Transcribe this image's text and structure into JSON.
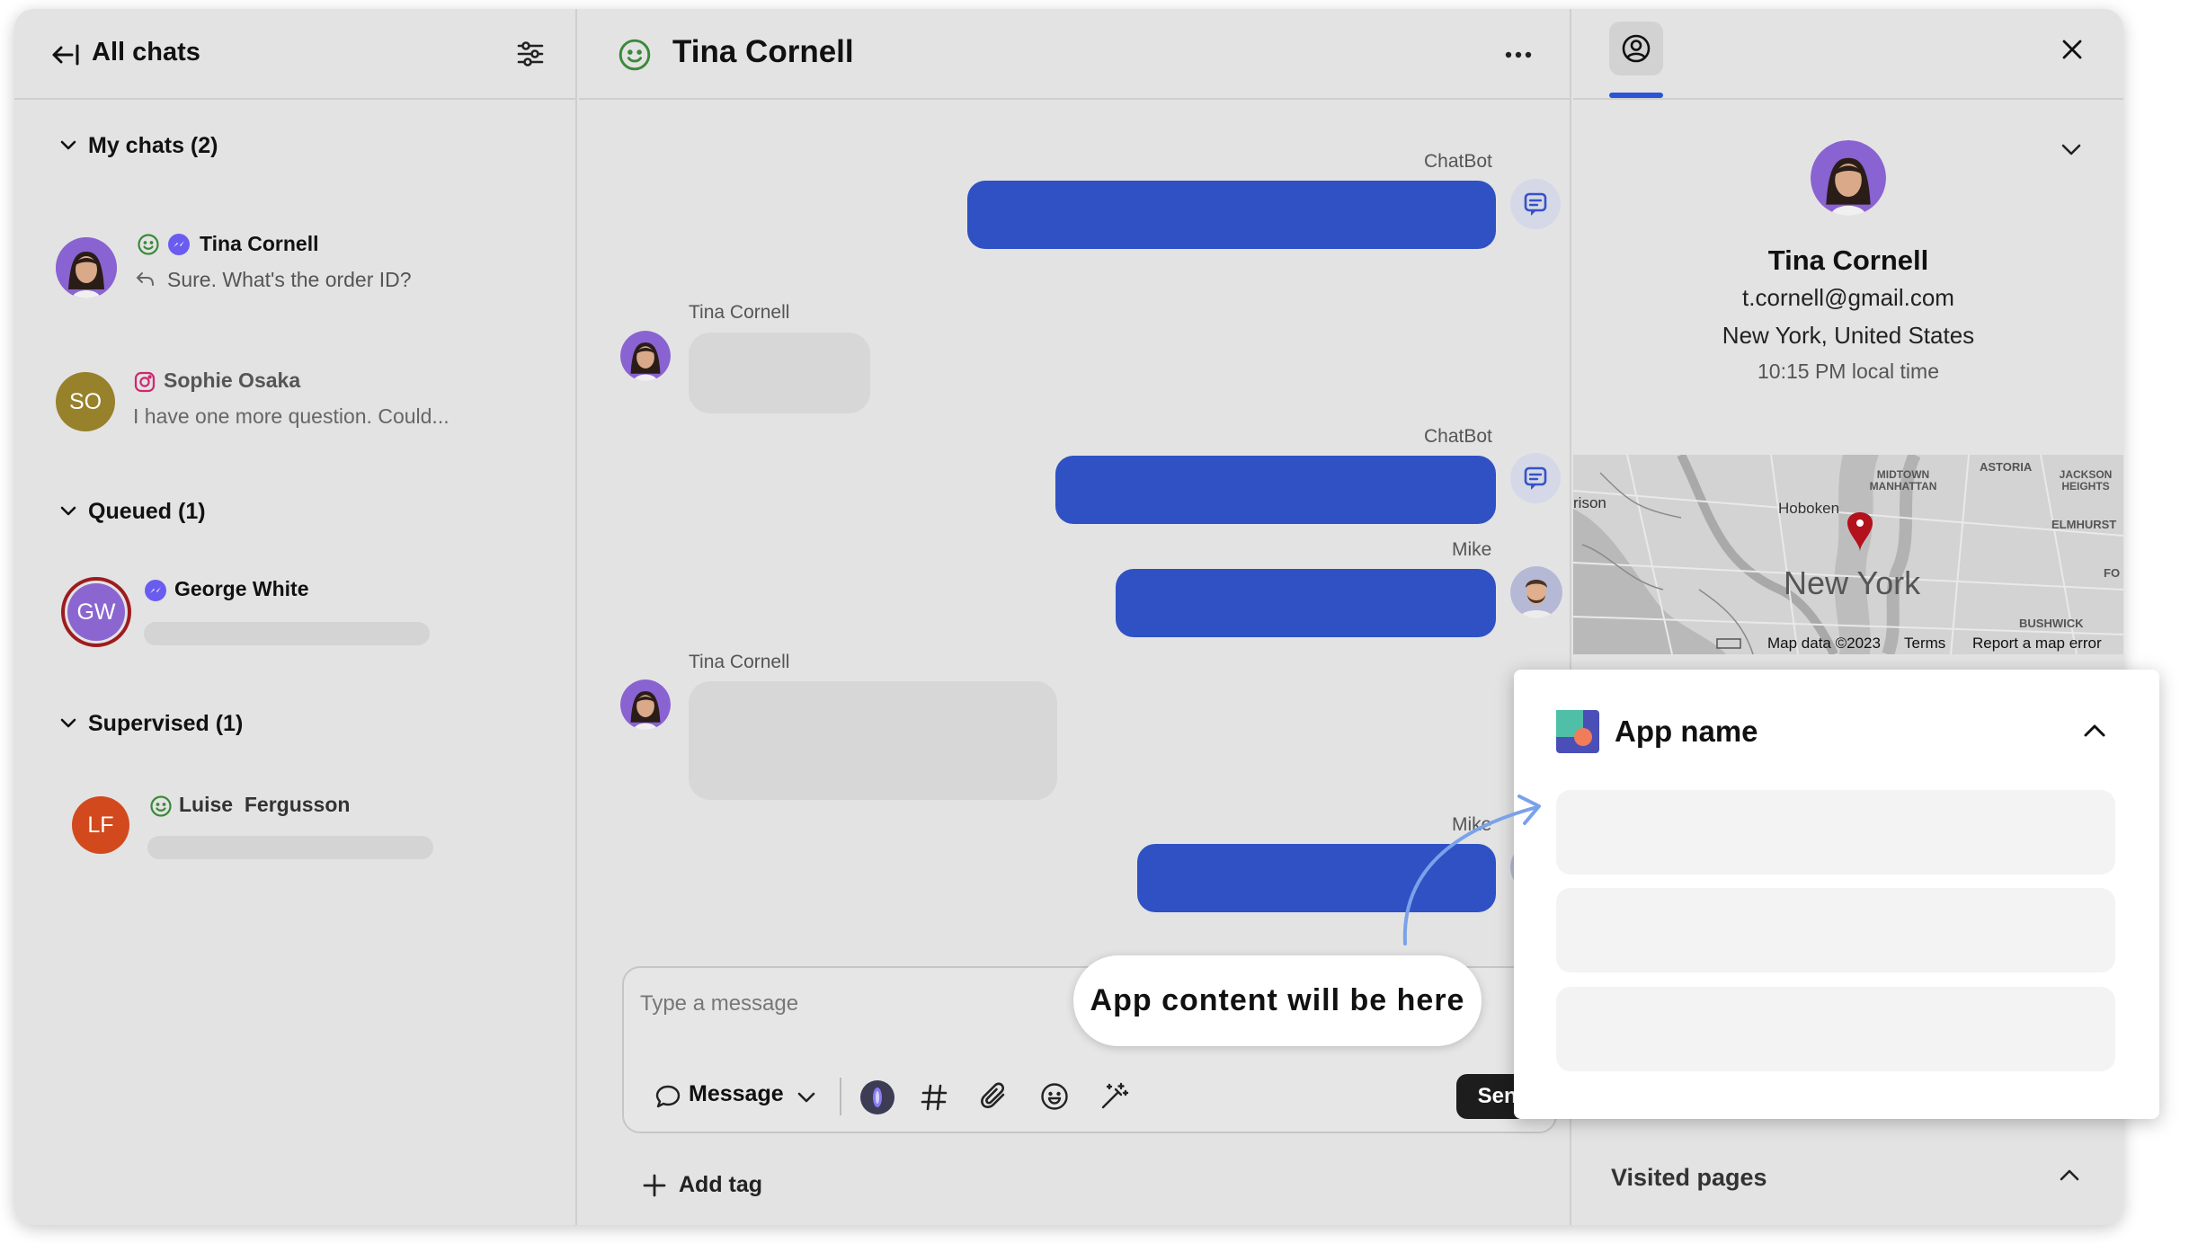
{
  "left_panel": {
    "title": "All chats",
    "sections": {
      "my_chats": "My chats (2)",
      "queued": "Queued (1)",
      "supervised": "Supervised (1)"
    },
    "chats": [
      {
        "name": "Tina Cornell",
        "preview": "Sure. What's the order ID?"
      },
      {
        "initials": "SO",
        "name": "Sophie Osaka",
        "preview": "I have one more question. Could..."
      },
      {
        "initials": "GW",
        "name": "George White"
      },
      {
        "initials": "LF",
        "name": "Luise  Fergusson"
      }
    ]
  },
  "chat": {
    "title": "Tina Cornell",
    "senders": {
      "bot1": "ChatBot",
      "tina1": "Tina Cornell",
      "bot2": "ChatBot",
      "mike1": "Mike",
      "tina2": "Tina Cornell",
      "mike2": "Mike"
    },
    "composer": {
      "placeholder": "Type a message",
      "mode": "Message",
      "send": "Send"
    },
    "add_tag": "Add tag",
    "callout": "App content will be here"
  },
  "details": {
    "name": "Tina Cornell",
    "email": "t.cornell@gmail.com",
    "location": "New York, United States",
    "local_time": "10:15 PM local time",
    "map": {
      "city": "New York",
      "labels": [
        "ASTORIA",
        "MIDTOWN MANHATTAN",
        "JACKSON HEIGHTS",
        "Hoboken",
        "rison",
        "ELMHURST",
        "BUSHWICK",
        "FO"
      ],
      "footer_data": "Map data ©2023",
      "footer_terms": "Terms",
      "footer_report": "Report a map error"
    },
    "app_name": "App name",
    "visited_pages": "Visited pages"
  },
  "colors": {
    "accent_blue": "#2f51c4",
    "tab_underline": "#2b55d4",
    "online_green": "#3a8a3a",
    "map_pin": "#b3111b"
  }
}
